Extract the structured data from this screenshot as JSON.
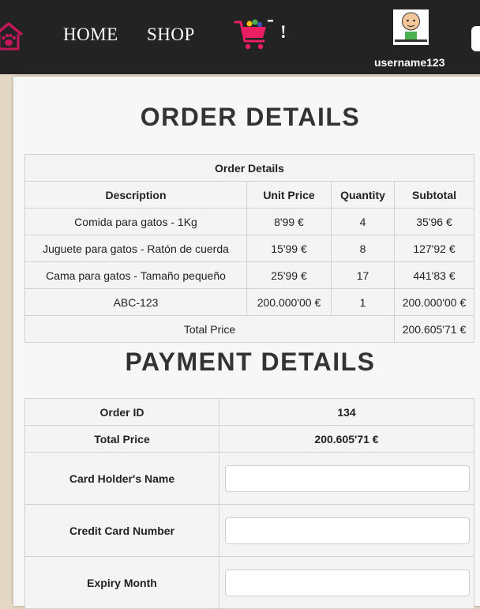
{
  "nav": {
    "home_label": "HOME",
    "shop_label": "SHOP",
    "cart_badge": "!",
    "username": "username123",
    "brand_color": "#c2185b",
    "icons": [
      "paw-house-icon",
      "shopping-cart-icon",
      "user-avatar"
    ]
  },
  "order": {
    "heading": "ORDER DETAILS",
    "table_caption": "Order Details",
    "columns": [
      "Description",
      "Unit Price",
      "Quantity",
      "Subtotal"
    ],
    "rows": [
      {
        "description": "Comida para gatos - 1Kg",
        "unit_price": "8'99 €",
        "quantity": "4",
        "subtotal": "35'96 €"
      },
      {
        "description": "Juguete para gatos - Ratón de cuerda",
        "unit_price": "15'99 €",
        "quantity": "8",
        "subtotal": "127'92 €"
      },
      {
        "description": "Cama para gatos - Tamaño pequeño",
        "unit_price": "25'99 €",
        "quantity": "17",
        "subtotal": "441'83 €"
      },
      {
        "description": "ABC-123",
        "unit_price": "200.000'00 €",
        "quantity": "1",
        "subtotal": "200.000'00 €"
      }
    ],
    "total_label": "Total Price",
    "total_value": "200.605'71 €"
  },
  "payment": {
    "heading": "PAYMENT DETAILS",
    "order_id_label": "Order ID",
    "order_id_value": "134",
    "total_label": "Total Price",
    "total_value": "200.605'71 €",
    "card_holder_label": "Card Holder's Name",
    "card_holder_value": "",
    "card_number_label": "Credit Card Number",
    "card_number_value": "",
    "expiry_month_label": "Expiry Month",
    "expiry_month_value": ""
  }
}
